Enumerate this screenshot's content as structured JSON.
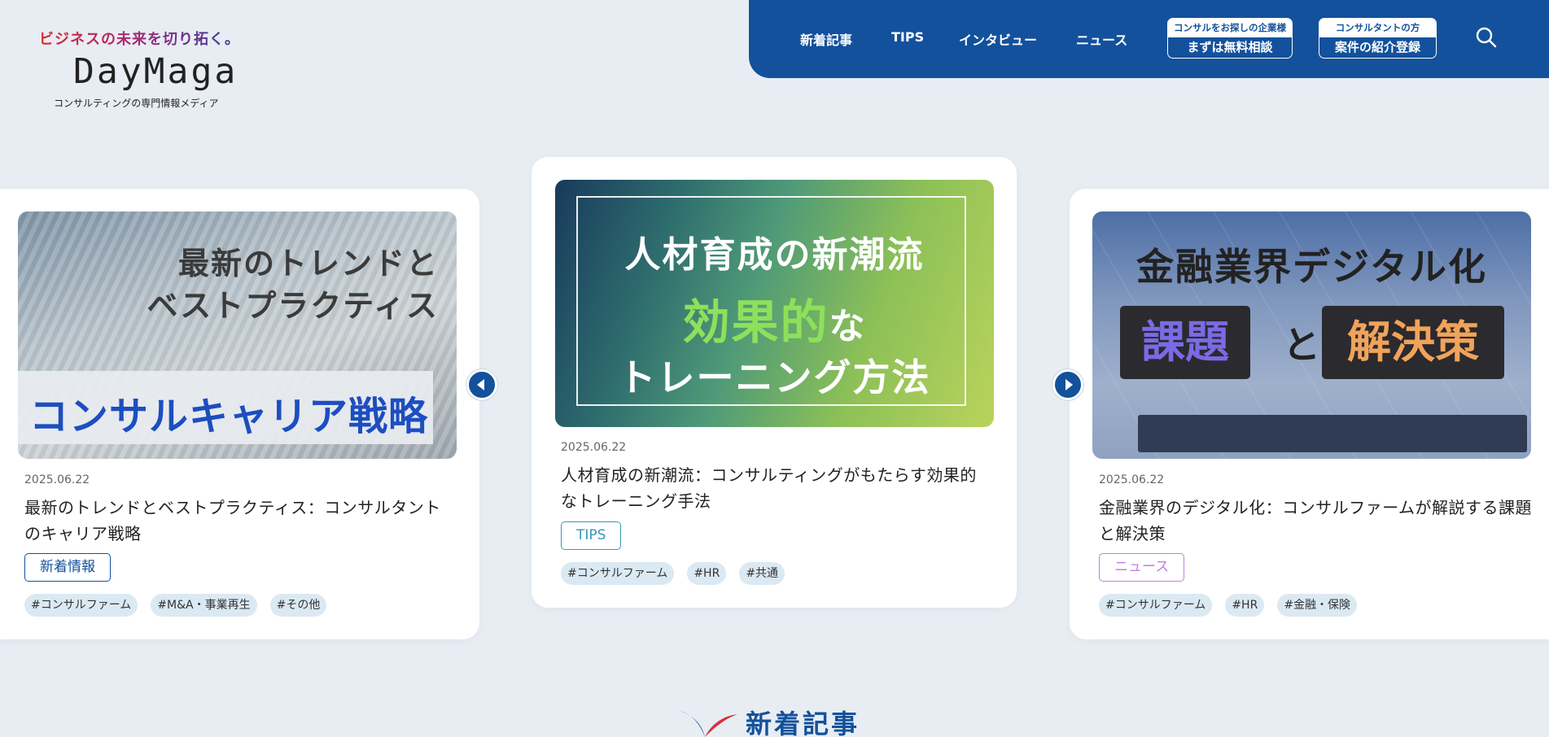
{
  "header": {
    "tagline": "ビジネスの未来を切り拓く。",
    "logo": "DayMaga",
    "subtitle": "コンサルティングの専門情報メディア"
  },
  "nav": {
    "items": [
      "新着記事",
      "TIPS",
      "インタビュー",
      "ニュース"
    ],
    "cta_company": {
      "top": "コンサルをお探しの企業様",
      "bottom": "まずは無料相談"
    },
    "cta_consultant": {
      "top": "コンサルタントの方",
      "bottom": "案件の紹介登録"
    },
    "search_icon": "search-icon"
  },
  "slider": {
    "prev_icon": "chevron-left-icon",
    "next_icon": "chevron-right-icon",
    "cards": [
      {
        "thumb_lines": [
          "最新のトレンドと",
          "ベストプラクティス",
          "コンサルキャリア戦略"
        ],
        "date": "2025.06.22",
        "title": "最新のトレンドとベストプラクティス：コンサルタントのキャリア戦略",
        "category": "新着情報",
        "category_color": "#13519c",
        "tags": [
          "#コンサルファーム",
          "#M&A・事業再生",
          "#その他"
        ]
      },
      {
        "thumb_lines": [
          "人材育成の新潮流",
          "効果的",
          "な",
          "トレーニング方法"
        ],
        "date": "2025.06.22",
        "title": "人材育成の新潮流：コンサルティングがもたらす効果的なトレーニング手法",
        "category": "TIPS",
        "category_color": "#3a98b4",
        "tags": [
          "#コンサルファーム",
          "#HR",
          "#共通"
        ]
      },
      {
        "thumb_lines": [
          "金融業界デジタル化",
          "課題",
          "と",
          "解決策"
        ],
        "date": "2025.06.22",
        "title": "金融業界のデジタル化：コンサルファームが解説する課題と解決策",
        "category": "ニュース",
        "category_color": "#c77be0",
        "tags": [
          "#コンサルファーム",
          "#HR",
          "#金融・保険"
        ]
      }
    ]
  },
  "section": {
    "heading": "新着記事",
    "icon": "section-swoosh-icon"
  }
}
